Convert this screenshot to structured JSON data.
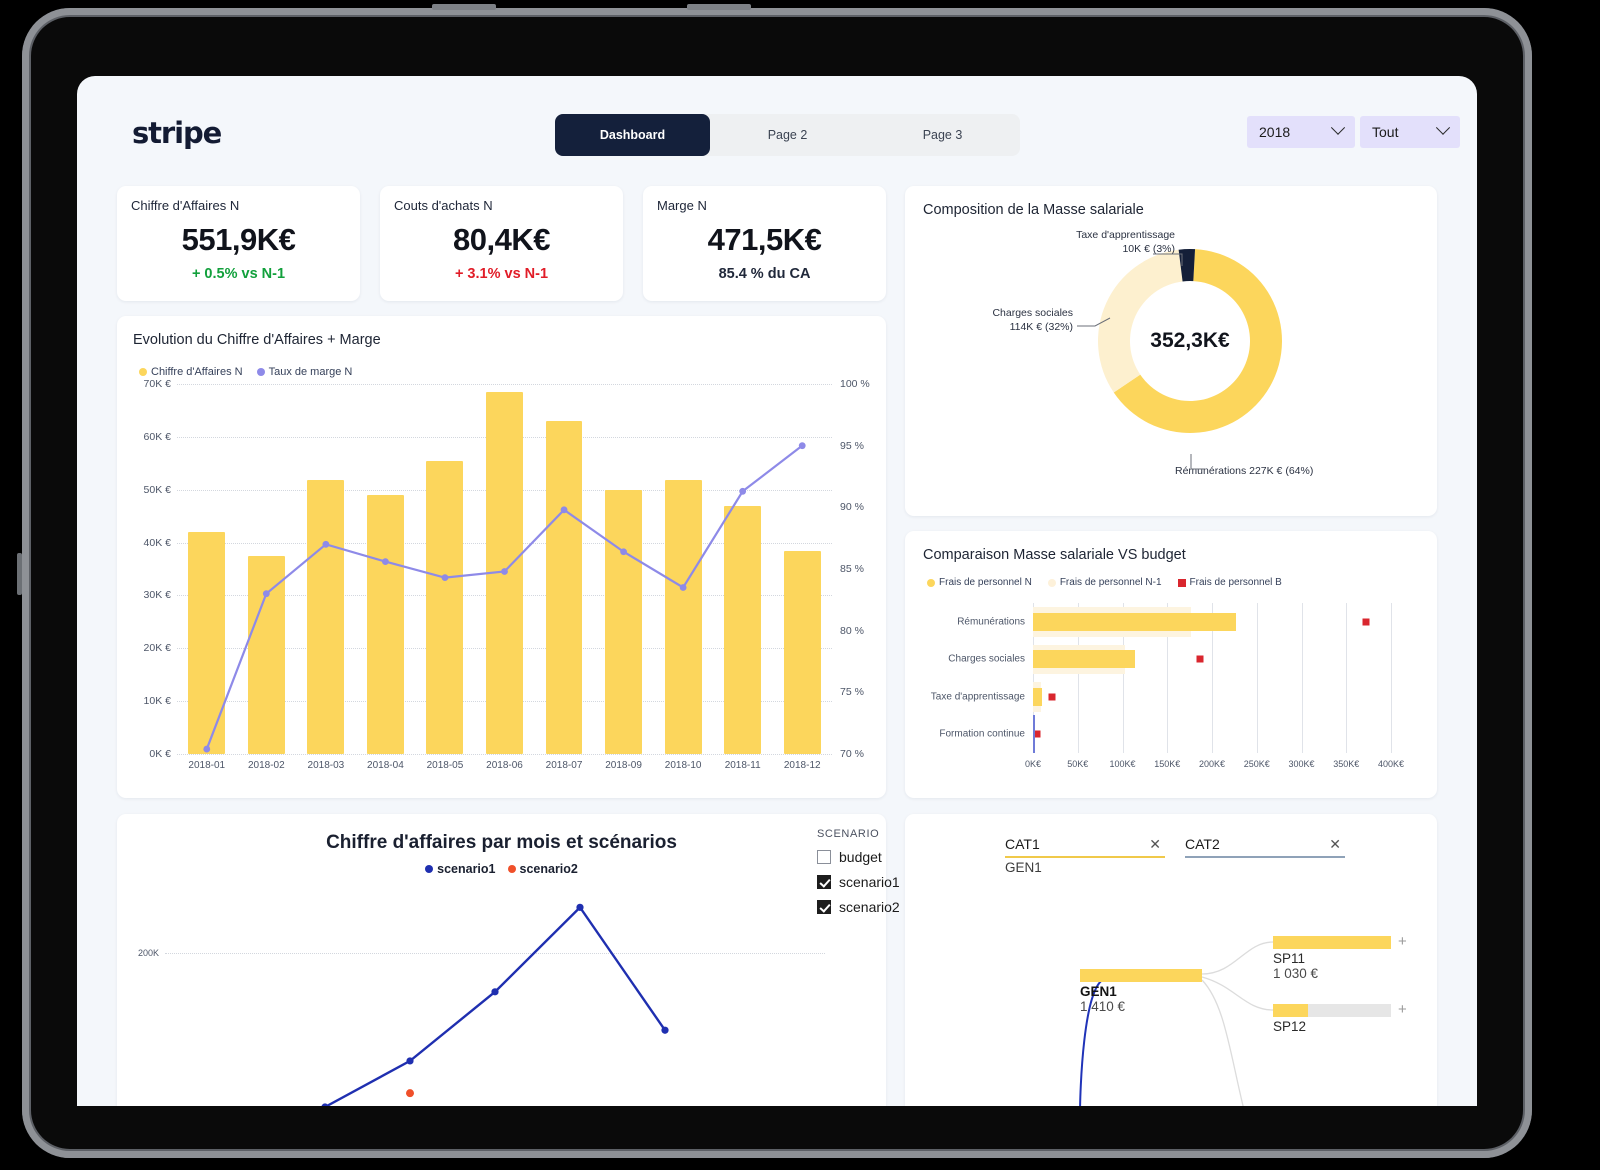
{
  "brand": {
    "logo": "stripe"
  },
  "nav": {
    "tabs": [
      {
        "label": "Dashboard",
        "active": true
      },
      {
        "label": "Page 2",
        "active": false
      },
      {
        "label": "Page 3",
        "active": false
      }
    ]
  },
  "filters": {
    "year": "2018",
    "scope": "Tout"
  },
  "kpis": [
    {
      "title": "Chiffre d'Affaires N",
      "value": "551,9K€",
      "delta": "+ 0.5%  vs N-1",
      "tone": "pos"
    },
    {
      "title": "Couts d'achats N",
      "value": "80,4K€",
      "delta": "+ 3.1%  vs N-1",
      "tone": "neg"
    },
    {
      "title": "Marge N",
      "value": "471,5K€",
      "delta": "85.4 %  du CA",
      "tone": "neutral"
    }
  ],
  "evolution": {
    "title": "Evolution du Chiffre d'Affaires + Marge",
    "legend": [
      {
        "label": "Chiffre d'Affaires N",
        "color": "#fcd65c"
      },
      {
        "label": "Taux de marge N",
        "color": "#8e8ae8"
      }
    ],
    "y_left_ticks": [
      "70K €",
      "60K €",
      "50K €",
      "40K €",
      "30K €",
      "20K €",
      "10K €",
      "0K €"
    ],
    "y_right_ticks": [
      "100 %",
      "95 %",
      "90 %",
      "85 %",
      "80 %",
      "75 %",
      "70 %"
    ]
  },
  "donut": {
    "title": "Composition de la Masse salariale",
    "center": "352,3K€",
    "labels": {
      "taxe": "Taxe d'apprentissage\n10K € (3%)",
      "taxe_l1": "Taxe d'apprentissage",
      "taxe_l2": "10K € (3%)",
      "charges_l1": "Charges sociales",
      "charges_l2": "114K € (32%)",
      "remu": "Rémunérations 227K € (64%)"
    }
  },
  "comparison": {
    "title": "Comparaison Masse salariale VS budget",
    "legend": [
      {
        "label": "Frais de personnel N",
        "color": "#fcd65c",
        "shape": "dot"
      },
      {
        "label": "Frais de personnel N-1",
        "color": "#fdf1da",
        "shape": "dot"
      },
      {
        "label": "Frais de personnel B",
        "color": "#d9262e",
        "shape": "square"
      }
    ]
  },
  "scenario": {
    "title": "Chiffre d'affaires par mois et scénarios",
    "legend": [
      {
        "label": "scenario1",
        "color": "#1f2fb0"
      },
      {
        "label": "scenario2",
        "color": "#f0502a"
      }
    ],
    "selector_title": "SCENARIO",
    "options": [
      {
        "label": "budget",
        "checked": false
      },
      {
        "label": "scenario1",
        "checked": true
      },
      {
        "label": "scenario2",
        "checked": true
      }
    ],
    "y_tick": "200K"
  },
  "tree": {
    "categories": [
      {
        "name": "CAT1",
        "underline": "#fcd65c",
        "child": "GEN1",
        "close": "✕"
      },
      {
        "name": "CAT2",
        "underline": "#7b8fa8",
        "child": "",
        "close": "✕"
      }
    ],
    "nodes": [
      {
        "name": "SP11",
        "value": "1 030 €",
        "bold": false,
        "plus": "+"
      },
      {
        "name": "GEN1",
        "value": "1 410 €",
        "bold": true,
        "plus": ""
      },
      {
        "name": "SP12",
        "value": "",
        "bold": false,
        "plus": "+"
      }
    ]
  },
  "chart_data": [
    {
      "type": "bar",
      "id": "evolution-combo",
      "title": "Evolution du Chiffre d'Affaires + Marge",
      "categories": [
        "2018-01",
        "2018-02",
        "2018-03",
        "2018-04",
        "2018-05",
        "2018-06",
        "2018-07",
        "2018-09",
        "2018-10",
        "2018-11",
        "2018-12"
      ],
      "series": [
        {
          "name": "Chiffre d'Affaires N",
          "type": "bar",
          "axis": "left",
          "values": [
            42000,
            37500,
            51800,
            49000,
            55500,
            68500,
            63000,
            50000,
            51800,
            47000,
            38500
          ],
          "color": "#fcd65c"
        },
        {
          "name": "Taux de marge N",
          "type": "line",
          "axis": "right",
          "values": [
            70.4,
            83.0,
            87.0,
            85.6,
            84.3,
            84.8,
            89.8,
            86.4,
            83.5,
            91.3,
            95.0
          ],
          "color": "#8e8ae8"
        }
      ],
      "ylabel": "",
      "ylim": [
        0,
        70000
      ],
      "y2label": "",
      "y2lim": [
        70,
        100
      ],
      "ytick_labels": [
        "0K €",
        "10K €",
        "20K €",
        "30K €",
        "40K €",
        "50K €",
        "60K €",
        "70K €"
      ],
      "y2tick_labels": [
        "70 %",
        "75 %",
        "80 %",
        "85 %",
        "90 %",
        "95 %",
        "100 %"
      ],
      "grid": true,
      "legend": "top-left"
    },
    {
      "type": "pie",
      "id": "masse-salariale-donut",
      "title": "Composition de la Masse salariale",
      "center_label": "352,3K€",
      "labels": [
        "Rémunérations",
        "Charges sociales",
        "Taxe d'apprentissage"
      ],
      "values": [
        227,
        114,
        10
      ],
      "unit": "K €",
      "percentages": [
        64,
        32,
        3
      ],
      "colors": [
        "#fcd65c",
        "#fdf0cf",
        "#141f38"
      ],
      "donut": true
    },
    {
      "type": "bar",
      "id": "comparaison-budget",
      "title": "Comparaison Masse salariale VS budget",
      "orientation": "horizontal",
      "categories": [
        "Rémunérations",
        "Charges sociales",
        "Taxe d'apprentissage",
        "Formation continue"
      ],
      "series": [
        {
          "name": "Frais de personnel N",
          "values": [
            227000,
            114000,
            10000,
            600
          ],
          "color": "#fcd65c"
        },
        {
          "name": "Frais de personnel N-1",
          "values": [
            176000,
            103000,
            9000,
            400
          ],
          "color": "#fdf1da"
        },
        {
          "name": "Frais de personnel B",
          "values": [
            372000,
            187000,
            21000,
            4000
          ],
          "color": "#d9262e",
          "type": "marker"
        }
      ],
      "xlim": [
        0,
        400000
      ],
      "xtick_labels": [
        "0K€",
        "50K€",
        "100K€",
        "150K€",
        "200K€",
        "250K€",
        "300K€",
        "350K€",
        "400K€"
      ],
      "grid": true,
      "legend": "top-left"
    },
    {
      "type": "line",
      "id": "ca-par-mois-scenarios",
      "title": "Chiffre d'affaires par mois et scénarios",
      "series": [
        {
          "name": "scenario1",
          "color": "#1f2fb0",
          "x": [
            0,
            1,
            2,
            3,
            4
          ],
          "values": [
            0,
            60000,
            150000,
            260000,
            100000
          ]
        },
        {
          "name": "scenario2",
          "color": "#f0502a",
          "x": [
            2
          ],
          "values": [
            18000
          ]
        }
      ],
      "ytick_labels": [
        "200K"
      ],
      "ylim": [
        0,
        280000
      ],
      "grid": true,
      "legend": "top-center"
    }
  ]
}
